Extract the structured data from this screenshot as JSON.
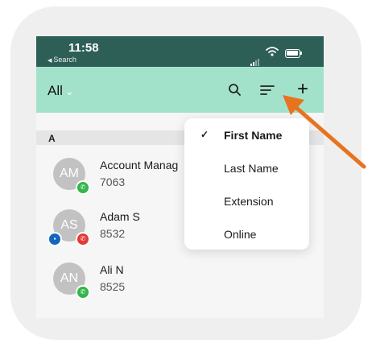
{
  "status_bar": {
    "time": "11:58",
    "back_label": "Search"
  },
  "toolbar": {
    "filter_label": "All",
    "icons": [
      "search-icon",
      "sort-icon",
      "add-icon"
    ]
  },
  "contacts": {
    "section_letter": "A",
    "items": [
      {
        "initials": "AM",
        "name": "Account Manag",
        "extension": "7063"
      },
      {
        "initials": "AS",
        "name": "Adam S",
        "extension": "8532"
      },
      {
        "initials": "AN",
        "name": "Ali N",
        "extension": "8525"
      }
    ]
  },
  "sort_menu": {
    "selected": "First Name",
    "options": [
      "First Name",
      "Last Name",
      "Extension",
      "Online"
    ]
  },
  "colors": {
    "status_bar": "#2e5f57",
    "toolbar": "#a2e2cb",
    "annotation_arrow": "#e8731f",
    "presence_green": "#33b54a",
    "presence_red": "#e53935",
    "presence_blue": "#1565c0"
  }
}
